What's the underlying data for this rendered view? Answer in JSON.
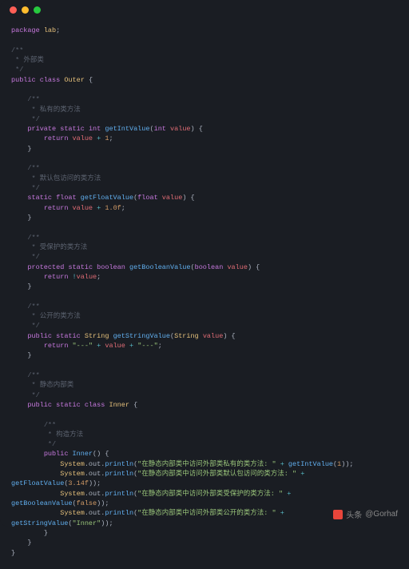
{
  "code": {
    "package_kw": "package",
    "package_name": "lab",
    "comment_outer": "外部类",
    "public_kw": "public",
    "class_kw": "class",
    "class_outer": "Outer",
    "comment_private": "私有的类方法",
    "private_kw": "private",
    "static_kw": "static",
    "int_type": "int",
    "getIntValue": "getIntValue",
    "int_param": "int",
    "value_param": "value",
    "return_kw": "return",
    "one": "1",
    "comment_default": "默认包访问的类方法",
    "float_type": "float",
    "getFloatValue": "getFloatValue",
    "onef": "1.0f",
    "comment_protected": "受保护的类方法",
    "protected_kw": "protected",
    "boolean_type": "boolean",
    "getBooleanValue": "getBooleanValue",
    "not_value": "!value",
    "comment_public": "公开的类方法",
    "string_type": "String",
    "getStringValue": "getStringValue",
    "dash_str": "\"---\"",
    "comment_inner": "静态内部类",
    "class_inner": "Inner",
    "comment_ctor": "构造方法",
    "Inner_ctor": "Inner",
    "sys_out": "System.out.println",
    "s1": "\"在静态内部类中访问外部类私有的类方法: \"",
    "s2": "\"在静态内部类中访问外部类默认包访问的类方法: \"",
    "s3": "\"在静态内部类中访问外部类受保护的类方法: \"",
    "s4": "\"在静态内部类中访问外部类公开的类方法: \"",
    "call1": "getIntValue",
    "arg1": "1",
    "call2": "getFloatValue",
    "arg2": "3.14f",
    "call3": "getBooleanValue",
    "arg3": "false",
    "call4": "getStringValue",
    "arg4": "\"Inner\""
  },
  "watermark": {
    "prefix": "头条",
    "handle": "@Gorhaf"
  }
}
